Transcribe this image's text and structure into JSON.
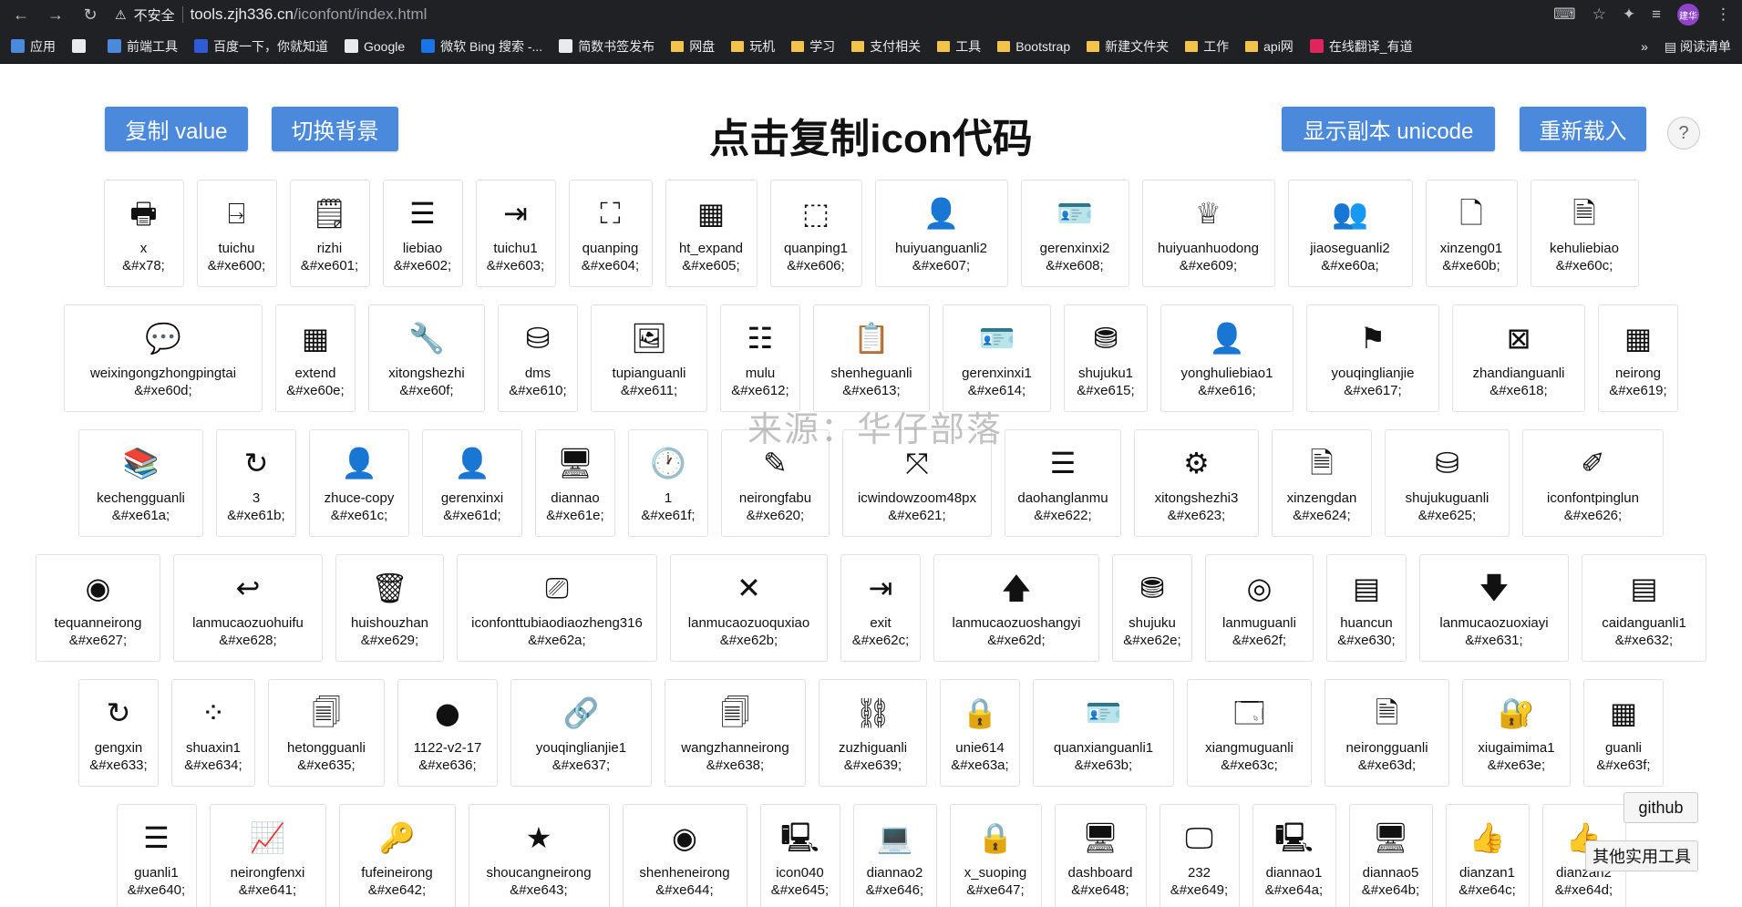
{
  "browser": {
    "insecure_label": "不安全",
    "url_domain": "tools.zjh336.cn",
    "url_path": "/iconfont/index.html",
    "profile_label": "建华",
    "bookmarks": [
      {
        "label": "应用",
        "color": "#4a89dc"
      },
      {
        "label": "",
        "color": "#e8eaed"
      },
      {
        "label": "前端工具",
        "color": "#4a89dc"
      },
      {
        "label": "百度一下，你就知道",
        "color": "#2f5cd6"
      },
      {
        "label": "Google",
        "color": "#e8eaed"
      },
      {
        "label": "微软 Bing 搜索 -...",
        "color": "#1a73e8"
      },
      {
        "label": "简数书签发布",
        "color": "#e8eaed"
      },
      {
        "label": "网盘",
        "color": "folder"
      },
      {
        "label": "玩机",
        "color": "folder"
      },
      {
        "label": "学习",
        "color": "folder"
      },
      {
        "label": "支付相关",
        "color": "folder"
      },
      {
        "label": "工具",
        "color": "folder"
      },
      {
        "label": "Bootstrap",
        "color": "folder"
      },
      {
        "label": "新建文件夹",
        "color": "folder"
      },
      {
        "label": "工作",
        "color": "folder"
      },
      {
        "label": "api网",
        "color": "folder"
      },
      {
        "label": "在线翻译_有道",
        "color": "#e0245e"
      }
    ],
    "more_label": "»",
    "reading_list_label": "阅读清单"
  },
  "toolbar": {
    "copy_value_label": "复制 value",
    "toggle_bg_label": "切换背景",
    "title": "点击复制icon代码",
    "show_unicode_label": "显示副本 unicode",
    "reload_label": "重新载入",
    "help_label": "?"
  },
  "watermark": "来源：华仔部落",
  "side": {
    "github_label": "github",
    "tools_label": "其他实用工具"
  },
  "rows": [
    [
      {
        "name": "x",
        "code": "&#x78;",
        "icon": "printer-icon",
        "glyph": "🖶"
      },
      {
        "name": "tuichu",
        "code": "&#xe600;",
        "icon": "exit-door-icon",
        "glyph": "⍈"
      },
      {
        "name": "rizhi",
        "code": "&#xe601;",
        "icon": "log-icon",
        "glyph": "🗒"
      },
      {
        "name": "liebiao",
        "code": "&#xe602;",
        "icon": "list-icon",
        "glyph": "☰"
      },
      {
        "name": "tuichu1",
        "code": "&#xe603;",
        "icon": "logout-icon",
        "glyph": "⇥"
      },
      {
        "name": "quanping",
        "code": "&#xe604;",
        "icon": "fullscreen-icon",
        "glyph": "⛶"
      },
      {
        "name": "ht_expand",
        "code": "&#xe605;",
        "icon": "expand-grid-icon",
        "glyph": "▦"
      },
      {
        "name": "quanping1",
        "code": "&#xe606;",
        "icon": "fullscreen-frame-icon",
        "glyph": "⬚"
      },
      {
        "name": "huiyuanguanli2",
        "code": "&#xe607;",
        "icon": "member-icon",
        "glyph": "👤"
      },
      {
        "name": "gerenxinxi2",
        "code": "&#xe608;",
        "icon": "id-card-icon",
        "glyph": "🪪"
      },
      {
        "name": "huiyuanhuodong",
        "code": "&#xe609;",
        "icon": "crown-icon",
        "glyph": "♕"
      },
      {
        "name": "jiaoseguanli2",
        "code": "&#xe60a;",
        "icon": "roles-icon",
        "glyph": "👥"
      },
      {
        "name": "xinzeng01",
        "code": "&#xe60b;",
        "icon": "new-file-icon",
        "glyph": "🗋"
      },
      {
        "name": "kehuliebiao",
        "code": "&#xe60c;",
        "icon": "customer-list-icon",
        "glyph": "🗎"
      }
    ],
    [
      {
        "name": "weixingongzhongpingtai",
        "code": "&#xe60d;",
        "icon": "wechat-icon",
        "glyph": "💬"
      },
      {
        "name": "extend",
        "code": "&#xe60e;",
        "icon": "grid-icon",
        "glyph": "▦"
      },
      {
        "name": "xitongshezhi",
        "code": "&#xe60f;",
        "icon": "wrench-icon",
        "glyph": "🔧"
      },
      {
        "name": "dms",
        "code": "&#xe610;",
        "icon": "database-hand-icon",
        "glyph": "⛁"
      },
      {
        "name": "tupianguanli",
        "code": "&#xe611;",
        "icon": "image-icon",
        "glyph": "🖼"
      },
      {
        "name": "mulu",
        "code": "&#xe612;",
        "icon": "catalog-icon",
        "glyph": "☷"
      },
      {
        "name": "shenheguanli",
        "code": "&#xe613;",
        "icon": "clipboard-check-icon",
        "glyph": "📋"
      },
      {
        "name": "gerenxinxi1",
        "code": "&#xe614;",
        "icon": "profile-card-icon",
        "glyph": "🪪"
      },
      {
        "name": "shujuku1",
        "code": "&#xe615;",
        "icon": "database-plus-icon",
        "glyph": "⛃"
      },
      {
        "name": "yonghuliebiao1",
        "code": "&#xe616;",
        "icon": "user-icon",
        "glyph": "👤"
      },
      {
        "name": "youqinglianjie",
        "code": "&#xe617;",
        "icon": "flag-icon",
        "glyph": "⚑"
      },
      {
        "name": "zhandianguanli",
        "code": "&#xe618;",
        "icon": "site-icon",
        "glyph": "⊠"
      },
      {
        "name": "neirong",
        "code": "&#xe619;",
        "icon": "content-icon",
        "glyph": "▦"
      }
    ],
    [
      {
        "name": "kechengguanli",
        "code": "&#xe61a;",
        "icon": "books-icon",
        "glyph": "📚"
      },
      {
        "name": "3",
        "code": "&#xe61b;",
        "icon": "refresh-icon",
        "glyph": "↻"
      },
      {
        "name": "zhuce-copy",
        "code": "&#xe61c;",
        "icon": "register-icon",
        "glyph": "👤"
      },
      {
        "name": "gerenxinxi",
        "code": "&#xe61d;",
        "icon": "person-icon",
        "glyph": "👤"
      },
      {
        "name": "diannao",
        "code": "&#xe61e;",
        "icon": "monitor-icon",
        "glyph": "🖥"
      },
      {
        "name": "1",
        "code": "&#xe61f;",
        "icon": "clock-icon",
        "glyph": "🕐"
      },
      {
        "name": "neirongfabu",
        "code": "&#xe620;",
        "icon": "edit-icon",
        "glyph": "✎"
      },
      {
        "name": "icwindowzoom48px",
        "code": "&#xe621;",
        "icon": "zoom-icon",
        "glyph": "⤧"
      },
      {
        "name": "daohanglanmu",
        "code": "&#xe622;",
        "icon": "menu-icon",
        "glyph": "☰"
      },
      {
        "name": "xitongshezhi3",
        "code": "&#xe623;",
        "icon": "settings-icon",
        "glyph": "⚙"
      },
      {
        "name": "xinzengdan",
        "code": "&#xe624;",
        "icon": "add-doc-icon",
        "glyph": "🗎"
      },
      {
        "name": "shujukuguanli",
        "code": "&#xe625;",
        "icon": "database-icon",
        "glyph": "⛁"
      },
      {
        "name": "iconfontpinglun",
        "code": "&#xe626;",
        "icon": "comment-edit-icon",
        "glyph": "✐"
      }
    ],
    [
      {
        "name": "tequanneirong",
        "code": "&#xe627;",
        "icon": "privilege-icon",
        "glyph": "◉"
      },
      {
        "name": "lanmucaozuohuifu",
        "code": "&#xe628;",
        "icon": "reply-icon",
        "glyph": "↩"
      },
      {
        "name": "huishouzhan",
        "code": "&#xe629;",
        "icon": "trash-icon",
        "glyph": "🗑"
      },
      {
        "name": "iconfonttubiaodiaozheng316",
        "code": "&#xe62a;",
        "icon": "adjust-icon",
        "glyph": "⎚"
      },
      {
        "name": "lanmucaozuoquxiao",
        "code": "&#xe62b;",
        "icon": "cancel-icon",
        "glyph": "✕"
      },
      {
        "name": "exit",
        "code": "&#xe62c;",
        "icon": "exit-icon",
        "glyph": "⇥"
      },
      {
        "name": "lanmucaozuoshangyi",
        "code": "&#xe62d;",
        "icon": "arrow-up-icon",
        "glyph": "🡅"
      },
      {
        "name": "shujuku",
        "code": "&#xe62e;",
        "icon": "database-stack-icon",
        "glyph": "⛃"
      },
      {
        "name": "lanmuguanli",
        "code": "&#xe62f;",
        "icon": "layers-icon",
        "glyph": "◎"
      },
      {
        "name": "huancun",
        "code": "&#xe630;",
        "icon": "cache-icon",
        "glyph": "▤"
      },
      {
        "name": "lanmucaozuoxiayi",
        "code": "&#xe631;",
        "icon": "arrow-down-icon",
        "glyph": "🡇"
      },
      {
        "name": "caidanguanli1",
        "code": "&#xe632;",
        "icon": "menu-manage-icon",
        "glyph": "▤"
      }
    ],
    [
      {
        "name": "gengxin",
        "code": "&#xe633;",
        "icon": "update-icon",
        "glyph": "↻"
      },
      {
        "name": "shuaxin1",
        "code": "&#xe634;",
        "icon": "spinner-icon",
        "glyph": "⁘"
      },
      {
        "name": "hetongguanli",
        "code": "&#xe635;",
        "icon": "contract-icon",
        "glyph": "🗐"
      },
      {
        "name": "1122-v2-17",
        "code": "&#xe636;",
        "icon": "circle-icon",
        "glyph": "●"
      },
      {
        "name": "youqinglianjie1",
        "code": "&#xe637;",
        "icon": "link-icon",
        "glyph": "🔗"
      },
      {
        "name": "wangzhanneirong",
        "code": "&#xe638;",
        "icon": "web-content-icon",
        "glyph": "🗐"
      },
      {
        "name": "zuzhiguanli",
        "code": "&#xe639;",
        "icon": "org-chart-icon",
        "glyph": "⛓"
      },
      {
        "name": "unie614",
        "code": "&#xe63a;",
        "icon": "lock-icon",
        "glyph": "🔒"
      },
      {
        "name": "quanxianguanli1",
        "code": "&#xe63b;",
        "icon": "permission-icon",
        "glyph": "🪪"
      },
      {
        "name": "xiangmuguanli",
        "code": "&#xe63c;",
        "icon": "project-icon",
        "glyph": "🗔"
      },
      {
        "name": "neirongguanli",
        "code": "&#xe63d;",
        "icon": "word-doc-icon",
        "glyph": "🗎"
      },
      {
        "name": "xiugaimima1",
        "code": "&#xe63e;",
        "icon": "password-lock-icon",
        "glyph": "🔐"
      },
      {
        "name": "guanli",
        "code": "&#xe63f;",
        "icon": "manage-grid-icon",
        "glyph": "▦"
      }
    ],
    [
      {
        "name": "guanli1",
        "code": "&#xe640;",
        "icon": "list-bullets-icon",
        "glyph": "☰"
      },
      {
        "name": "neirongfenxi",
        "code": "&#xe641;",
        "icon": "analytics-monitor-icon",
        "glyph": "📈"
      },
      {
        "name": "fufeineirong",
        "code": "&#xe642;",
        "icon": "key-icon",
        "glyph": "🔑"
      },
      {
        "name": "shoucangneirong",
        "code": "&#xe643;",
        "icon": "star-icon",
        "glyph": "★"
      },
      {
        "name": "shenheneirong",
        "code": "&#xe644;",
        "icon": "review-user-icon",
        "glyph": "◉"
      },
      {
        "name": "icon040",
        "code": "&#xe645;",
        "icon": "computer-icon",
        "glyph": "🖳"
      },
      {
        "name": "diannao2",
        "code": "&#xe646;",
        "icon": "laptop-icon",
        "glyph": "💻"
      },
      {
        "name": "x_suoping",
        "code": "&#xe647;",
        "icon": "lock-screen-icon",
        "glyph": "🔒"
      },
      {
        "name": "dashboard",
        "code": "&#xe648;",
        "icon": "dashboard-monitor-icon",
        "glyph": "🖥"
      },
      {
        "name": "232",
        "code": "&#xe649;",
        "icon": "desktop-icon",
        "glyph": "🖵"
      },
      {
        "name": "diannao1",
        "code": "&#xe64a;",
        "icon": "small-monitor-icon",
        "glyph": "🖳"
      },
      {
        "name": "diannao5",
        "code": "&#xe64b;",
        "icon": "pc-icon",
        "glyph": "🖥"
      },
      {
        "name": "dianzan1",
        "code": "&#xe64c;",
        "icon": "thumbs-up-icon",
        "glyph": "👍"
      },
      {
        "name": "dianzan2",
        "code": "&#xe64d;",
        "icon": "thumbs-up-outline-icon",
        "glyph": "👍"
      }
    ]
  ]
}
